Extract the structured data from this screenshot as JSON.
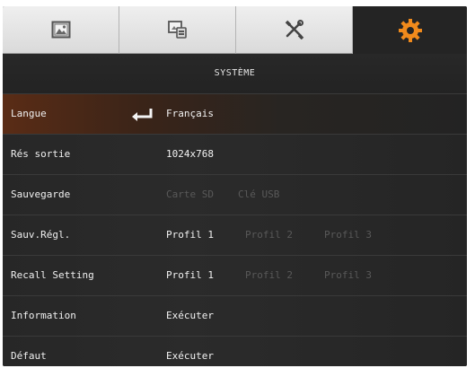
{
  "tabs": [
    {
      "icon": "picture-icon",
      "active": false
    },
    {
      "icon": "camera-settings-icon",
      "active": false
    },
    {
      "icon": "tools-icon",
      "active": false
    },
    {
      "icon": "gear-icon",
      "active": true
    }
  ],
  "colors": {
    "accent": "#f08a1c",
    "panel": "#202020",
    "selected_row": "#5a2c16",
    "dim_text": "#595959"
  },
  "header": {
    "title": "SYSTÈME"
  },
  "rows": [
    {
      "label": "Langue",
      "selected": true,
      "values": [
        "Français"
      ]
    },
    {
      "label": "Rés sortie",
      "values": [
        "1024x768"
      ]
    },
    {
      "label": "Sauvegarde",
      "values": [
        "Carte SD",
        "Clé USB"
      ]
    },
    {
      "label": "Sauv.Régl.",
      "values": [
        "Profil 1",
        "Profil 2",
        "Profil 3"
      ]
    },
    {
      "label": "Recall Setting",
      "values": [
        "Profil 1",
        "Profil 2",
        "Profil 3"
      ]
    },
    {
      "label": "Information",
      "values": [
        "Exécuter"
      ]
    },
    {
      "label": "Défaut",
      "values": [
        "Exécuter"
      ]
    }
  ]
}
